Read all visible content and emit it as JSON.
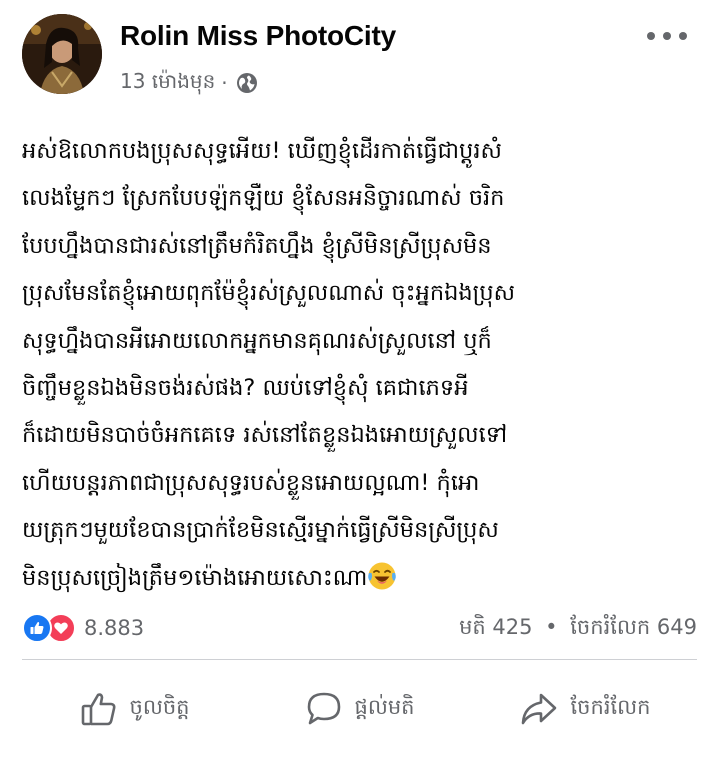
{
  "post": {
    "author": "Rolin Miss PhotoCity",
    "timestamp": "13 ម៉ោងមុន",
    "separator": "·",
    "privacy_icon": "globe-icon",
    "menu_icon": "more-dots-icon",
    "body_lines": [
      "អស់ឱលោកបងប្រុសសុទ្ធអើយ! ឃើញខ្ញុំដើរកាត់ធ្វើជាប្តូរសំ",
      "លេងម្ទែកៗ ស្រែកបែបឡ៉កឡឺយ ខ្ញុំសែនអនិច្ចារណាស់ ចរិក",
      "បែបហ្នឹងបានជារស់នៅត្រឹមកំរិតហ្នឹង ខ្ញុំស្រីមិនស្រីប្រុសមិន",
      "ប្រុសមែនតែខ្ញុំអោយពុកម៉ែខ្ញុំរស់ស្រួលណាស់ ចុះអ្នកឯងប្រុស",
      "សុទ្ធហ្នឹងបានអីអោយលោកអ្នកមានគុណរស់ស្រួលនៅ ឬក៏",
      "ចិញ្ចឹមខ្លួនឯងមិនចង់រស់ផង? ឈប់ទៅខ្ញុំសុំ គេជាភេទអី",
      "ក៏ដោយមិនបាច់ចំអកគេទេ រស់នៅតែខ្លួនឯងអោយស្រួលទៅ",
      "ហើយបន្តរភាពជាប្រុសសុទ្ធរបស់ខ្លួនអោយល្អណា! កុំអោ",
      "យត្រុកៗមួយខែបានប្រាក់ខែមិនស្មើរម្នាក់ធ្វើស្រីមិនស្រីប្រុស",
      "មិនប្រុសច្រៀងត្រឹម១ម៉ោងអោយសោះណា"
    ],
    "emoji": "face-with-tears-of-joy-icon"
  },
  "engagement": {
    "reaction_icons": [
      "like-reaction-icon",
      "love-reaction-icon"
    ],
    "reaction_count": "8.883",
    "comments_label": "មតិ 425",
    "stats_separator": "•",
    "shares_label": "ចែករំលែក 649"
  },
  "actions": {
    "like_label": "ចូលចិត្ត",
    "comment_label": "ផ្តល់មតិ",
    "share_label": "ចែករំលែក"
  },
  "colors": {
    "text": "#050505",
    "secondary": "#65676b",
    "like_blue": "#1877f2",
    "love_red": "#f33e58",
    "divider": "#ced0d4"
  }
}
